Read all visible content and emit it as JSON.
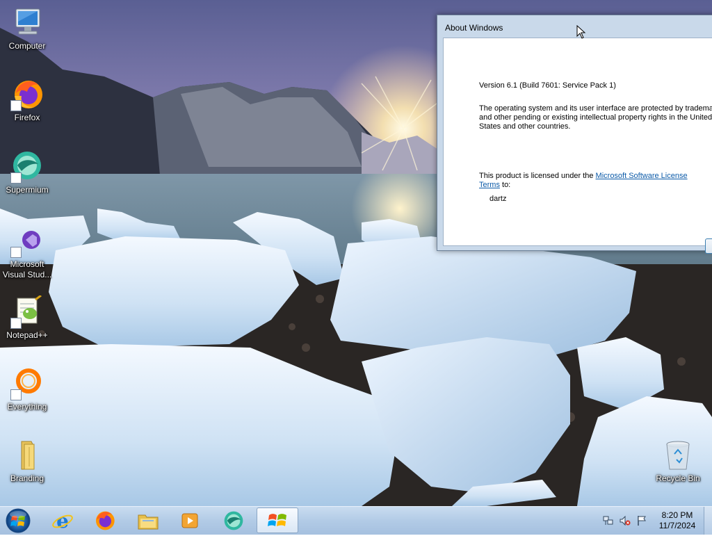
{
  "desktop": {
    "icons": [
      {
        "label": "Computer",
        "icon": "computer-icon"
      },
      {
        "label": "Firefox",
        "icon": "firefox-icon"
      },
      {
        "label": "Supermium",
        "icon": "supermium-icon"
      },
      {
        "label": "Microsoft Visual Stud...",
        "icon": "visual-studio-icon"
      },
      {
        "label": "Notepad++",
        "icon": "notepad-plus-plus-icon"
      },
      {
        "label": "Everything",
        "icon": "everything-search-icon"
      },
      {
        "label": "Branding",
        "icon": "folder-icon"
      },
      {
        "label": "Recycle Bin",
        "icon": "recycle-bin-icon"
      }
    ]
  },
  "about_window": {
    "title": "About Windows",
    "version": "Version 6.1 (Build 7601: Service Pack 1)",
    "protection_line1": "The  operating system and its user interface are protected by tradema",
    "protection_line2": "and other pending or existing intellectual property rights in the United",
    "protection_line3": "States and other countries.",
    "license_prefix": "This product is licensed under the ",
    "license_link_part1": "Microsoft Software License",
    "license_link_part2": "Terms",
    "license_suffix": " to:",
    "licensed_user": "dartz"
  },
  "taskbar": {
    "start_icon": "windows-start-orb-icon",
    "pinned": [
      {
        "name": "Internet Explorer",
        "icon": "internet-explorer-icon"
      },
      {
        "name": "Firefox",
        "icon": "firefox-icon"
      },
      {
        "name": "Windows Explorer",
        "icon": "file-explorer-icon"
      },
      {
        "name": "Windows Media Player",
        "icon": "media-player-icon"
      },
      {
        "name": "Supermium",
        "icon": "supermium-icon"
      },
      {
        "name": "About Windows",
        "icon": "windows-flag-icon",
        "active": true
      }
    ],
    "tray": {
      "icons": [
        "network-icon",
        "volume-muted-icon",
        "action-center-flag-icon"
      ],
      "time": "8:20 PM",
      "date": "11/7/2024"
    }
  },
  "colors": {
    "taskbar": "#b2cbe6",
    "window_frame": "#c9d9ea",
    "link": "#0b5aa8"
  }
}
